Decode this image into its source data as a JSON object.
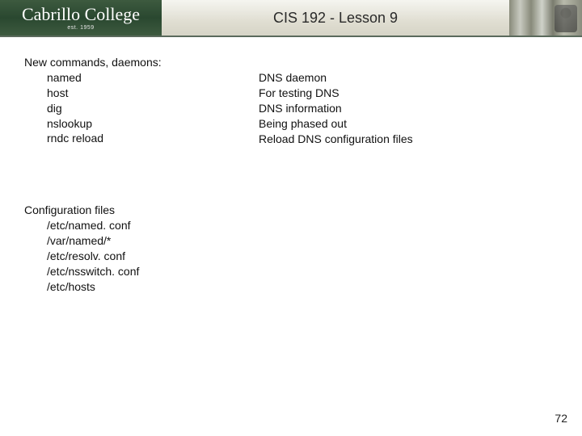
{
  "header": {
    "logo_main": "Cabrillo College",
    "logo_sub": "est. 1959",
    "title": "CIS 192 - Lesson 9"
  },
  "commands": {
    "heading": "New commands, daemons:",
    "items": [
      "named",
      "host",
      "dig",
      "nslookup",
      "rndc reload"
    ],
    "descriptions": [
      "DNS daemon",
      "For testing DNS",
      "DNS information",
      "Being phased out",
      "Reload DNS configuration files"
    ]
  },
  "config": {
    "heading": "Configuration files",
    "items": [
      "/etc/named. conf",
      "/var/named/*",
      "/etc/resolv. conf",
      "/etc/nsswitch. conf",
      "/etc/hosts"
    ]
  },
  "page_number": "72"
}
